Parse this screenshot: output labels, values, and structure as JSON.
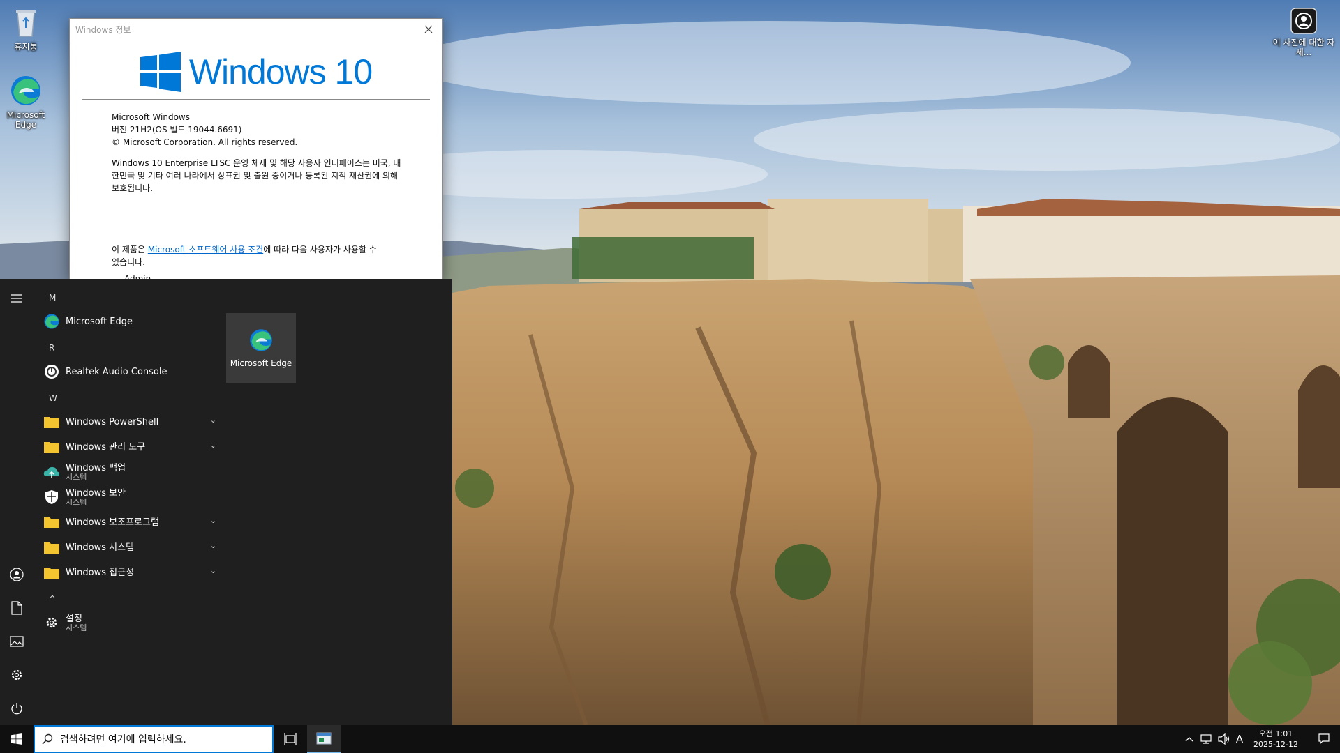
{
  "desktop": {
    "icons": [
      {
        "label": "휴지통"
      },
      {
        "label": "Microsoft Edge"
      },
      {
        "label": "이 사진에 대한 자세..."
      }
    ]
  },
  "about_window": {
    "title": "Windows 정보",
    "logo_text": "Windows 10",
    "product": "Microsoft Windows",
    "version": "버전 21H2(OS 빌드 19044.6691)",
    "copyright": "© Microsoft Corporation. All rights reserved.",
    "description": "Windows 10 Enterprise LTSC 운영 체제 및 해당 사용자 인터페이스는 미국, 대한민국 및 기타 여러 나라에서 상표권 및 출원 중이거나 등록된 지적 재산권에 의해 보호됩니다.",
    "license_prefix": "이 제품은 ",
    "license_link": "Microsoft 소프트웨어 사용 조건",
    "license_suffix": "에 따라 다음 사용자가 사용할 수 있습니다.",
    "user": "Admin"
  },
  "start_menu": {
    "letters": {
      "m": "M",
      "r": "R",
      "w": "W",
      "caret": "^"
    },
    "apps": [
      {
        "label": "Microsoft Edge"
      },
      {
        "label": "Realtek Audio Console"
      },
      {
        "label": "Windows PowerShell"
      },
      {
        "label": "Windows 관리 도구"
      },
      {
        "label": "Windows 백업",
        "sub": "시스템"
      },
      {
        "label": "Windows 보안",
        "sub": "시스템"
      },
      {
        "label": "Windows 보조프로그램"
      },
      {
        "label": "Windows 시스템"
      },
      {
        "label": "Windows 접근성"
      },
      {
        "label": "설정",
        "sub": "시스템"
      }
    ],
    "tile": {
      "label": "Microsoft Edge"
    }
  },
  "taskbar": {
    "search_placeholder": "검색하려면 여기에 입력하세요.",
    "ime": "A",
    "time": "오전 1:01",
    "date": "2025-12-12"
  },
  "colors": {
    "accent": "#0078d7",
    "start_bg": "#1f1f1f",
    "taskbar_bg": "#101010",
    "folder": "#f4c430"
  }
}
